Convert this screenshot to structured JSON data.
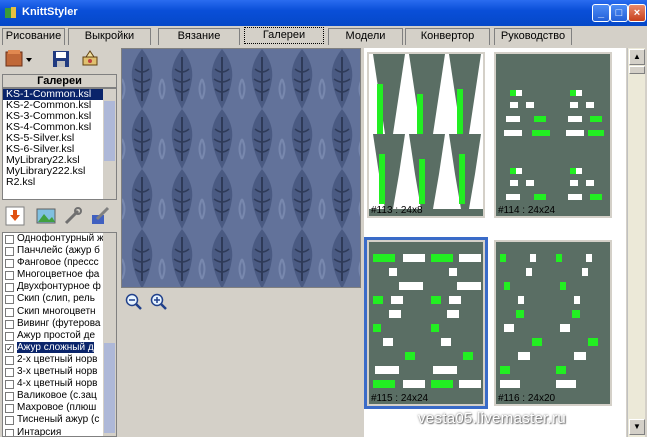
{
  "window": {
    "title": "KnittStyler"
  },
  "tabs": [
    {
      "label": "Рисование"
    },
    {
      "label": "Выкройки"
    },
    {
      "label": "Вязание"
    },
    {
      "label": "Галереи"
    },
    {
      "label": "Модели"
    },
    {
      "label": "Конвертор"
    },
    {
      "label": "Руководство"
    }
  ],
  "galleries": {
    "header": "Галереи",
    "items": [
      "KS-1-Common.ksl",
      "KS-2-Common.ksl",
      "KS-3-Common.ksl",
      "KS-4-Common.ksl",
      "KS-5-Silver.ksl",
      "KS-6-Silver.ksl",
      "MyLibrary22.ksl",
      "MyLibrary222.ksl",
      "R2.ksl"
    ],
    "selected_index": 0
  },
  "patterns": {
    "items": [
      {
        "label": "Однофонтурный ж",
        "checked": false
      },
      {
        "label": "Панчлейс (ажур б",
        "checked": false
      },
      {
        "label": "Фанговое (прессс",
        "checked": false
      },
      {
        "label": "Многоцветное фа",
        "checked": false
      },
      {
        "label": "Двухфонтурное ф",
        "checked": false
      },
      {
        "label": "Скип (слип, рель",
        "checked": false
      },
      {
        "label": "Скип многоцветн",
        "checked": false
      },
      {
        "label": "Вивинг (футерова",
        "checked": false
      },
      {
        "label": "Ажур простой де",
        "checked": false
      },
      {
        "label": "Ажур сложный д",
        "checked": true
      },
      {
        "label": "2-х цветный норв",
        "checked": false
      },
      {
        "label": "3-х цветный норв",
        "checked": false
      },
      {
        "label": "4-х цветный норв",
        "checked": false
      },
      {
        "label": "Валиковое (с.зац",
        "checked": false
      },
      {
        "label": "Махровое (плюш",
        "checked": false
      },
      {
        "label": "Тисненый ажур (с",
        "checked": false
      },
      {
        "label": "Интарсия",
        "checked": false
      }
    ],
    "selected_index": 9
  },
  "gallery": {
    "thumbnails": [
      {
        "caption": "#113 : 24x8"
      },
      {
        "caption": "#114 : 24x24"
      },
      {
        "caption": "#115 : 24x24"
      },
      {
        "caption": "#116 : 24x20"
      }
    ],
    "selected_index": 2
  },
  "watermark": "vesta05.livemaster.ru",
  "colors": {
    "titlebar": "#0a4fd8",
    "selection": "#0a246a",
    "pattern_green": "#22ee22",
    "pattern_bg": "#5a6e64"
  }
}
